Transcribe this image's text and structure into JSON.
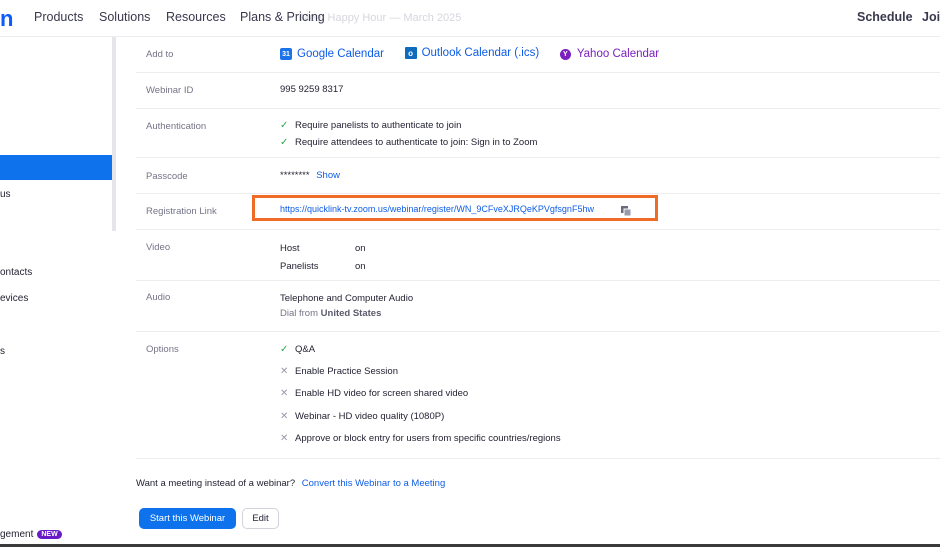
{
  "nav": {
    "logo_fragment": "n",
    "items": [
      "Products",
      "Solutions",
      "Resources",
      "Plans & Pricing"
    ],
    "ghost_text": "Meet Happy Hour — March 2025",
    "right_items": [
      "Schedule",
      "Join"
    ]
  },
  "sidebar": {
    "items": [
      {
        "label": "us"
      },
      {
        "label": "ontacts"
      },
      {
        "label": "evices"
      },
      {
        "label": "s"
      },
      {
        "label": "gement",
        "badge": "NEW"
      }
    ]
  },
  "details": {
    "add_to": {
      "label": "Add to",
      "google": "Google Calendar",
      "outlook": "Outlook Calendar (.ics)",
      "yahoo": "Yahoo Calendar",
      "google_icon_text": "31",
      "outlook_icon_text": "o",
      "yahoo_icon_text": "Y"
    },
    "webinar_id": {
      "label": "Webinar ID",
      "value": "995 9259 8317"
    },
    "authentication": {
      "label": "Authentication",
      "items": [
        "Require panelists to authenticate to join",
        "Require attendees to authenticate to join: Sign in to Zoom"
      ]
    },
    "passcode": {
      "label": "Passcode",
      "value": "********",
      "show_label": "Show"
    },
    "registration": {
      "label": "Registration Link",
      "url": "https://quicklink-tv.zoom.us/webinar/register/WN_9CFveXJRQeKPVgfsgnF5hw"
    },
    "video": {
      "label": "Video",
      "host_label": "Host",
      "host_value": "on",
      "panelists_label": "Panelists",
      "panelists_value": "on"
    },
    "audio": {
      "label": "Audio",
      "value": "Telephone and Computer Audio",
      "dial_prefix": "Dial from",
      "dial_country": "United States"
    },
    "options": {
      "label": "Options",
      "items": [
        {
          "text": "Q&A",
          "enabled": true
        },
        {
          "text": "Enable Practice Session",
          "enabled": false
        },
        {
          "text": "Enable HD video for screen shared video",
          "enabled": false
        },
        {
          "text": "Webinar - HD video quality (1080P)",
          "enabled": false
        },
        {
          "text": "Approve or block entry for users from specific countries/regions",
          "enabled": false
        }
      ]
    }
  },
  "footer": {
    "question": "Want a meeting instead of a webinar?",
    "convert_link": "Convert this Webinar to a Meeting",
    "start_button": "Start this Webinar",
    "edit_button": "Edit"
  },
  "colors": {
    "accent": "#0e72ed",
    "link": "#0e5ce6",
    "highlight_border": "#ee6b28",
    "check": "#2aa84a",
    "new_badge": "#6a1bc8"
  }
}
